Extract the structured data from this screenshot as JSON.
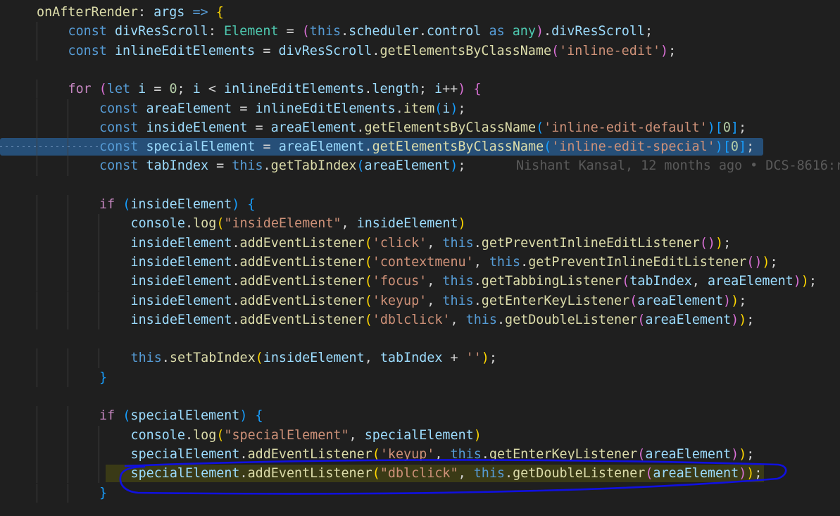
{
  "editor": {
    "language": "TypeScript",
    "lines": [
      {
        "indent": 1,
        "tokens": [
          [
            "fn",
            "onAfterRender"
          ],
          [
            "pl",
            ": "
          ],
          [
            "var",
            "args"
          ],
          [
            "pl",
            " "
          ],
          [
            "kw",
            "=>"
          ],
          [
            "pl",
            " "
          ],
          [
            "p1",
            "{"
          ]
        ]
      },
      {
        "indent": 2,
        "tokens": [
          [
            "kw",
            "const"
          ],
          [
            "pl",
            " "
          ],
          [
            "var",
            "divResScroll"
          ],
          [
            "pl",
            ": "
          ],
          [
            "type",
            "Element"
          ],
          [
            "pl",
            " = "
          ],
          [
            "p2",
            "("
          ],
          [
            "kw",
            "this"
          ],
          [
            "pl",
            "."
          ],
          [
            "var",
            "scheduler"
          ],
          [
            "pl",
            "."
          ],
          [
            "var",
            "control"
          ],
          [
            "pl",
            " "
          ],
          [
            "kw",
            "as"
          ],
          [
            "pl",
            " "
          ],
          [
            "type",
            "any"
          ],
          [
            "p2",
            ")"
          ],
          [
            "pl",
            "."
          ],
          [
            "var",
            "divResScroll"
          ],
          [
            "pl",
            ";"
          ]
        ]
      },
      {
        "indent": 2,
        "tokens": [
          [
            "kw",
            "const"
          ],
          [
            "pl",
            " "
          ],
          [
            "var",
            "inlineEditElements"
          ],
          [
            "pl",
            " = "
          ],
          [
            "var",
            "divResScroll"
          ],
          [
            "pl",
            "."
          ],
          [
            "fn",
            "getElementsByClassName"
          ],
          [
            "p2",
            "("
          ],
          [
            "str",
            "'inline-edit'"
          ],
          [
            "p2",
            ")"
          ],
          [
            "pl",
            ";"
          ]
        ]
      },
      {
        "indent": 0,
        "tokens": []
      },
      {
        "indent": 2,
        "tokens": [
          [
            "ctl",
            "for"
          ],
          [
            "pl",
            " "
          ],
          [
            "p2",
            "("
          ],
          [
            "kw",
            "let"
          ],
          [
            "pl",
            " "
          ],
          [
            "var",
            "i"
          ],
          [
            "pl",
            " = "
          ],
          [
            "num",
            "0"
          ],
          [
            "pl",
            "; "
          ],
          [
            "var",
            "i"
          ],
          [
            "pl",
            " < "
          ],
          [
            "var",
            "inlineEditElements"
          ],
          [
            "pl",
            "."
          ],
          [
            "var",
            "length"
          ],
          [
            "pl",
            "; "
          ],
          [
            "var",
            "i"
          ],
          [
            "pl",
            "++"
          ],
          [
            "p2",
            ")"
          ],
          [
            "pl",
            " "
          ],
          [
            "p2",
            "{"
          ]
        ]
      },
      {
        "indent": 3,
        "tokens": [
          [
            "kw",
            "const"
          ],
          [
            "pl",
            " "
          ],
          [
            "var",
            "areaElement"
          ],
          [
            "pl",
            " = "
          ],
          [
            "var",
            "inlineEditElements"
          ],
          [
            "pl",
            "."
          ],
          [
            "fn",
            "item"
          ],
          [
            "p3",
            "("
          ],
          [
            "var",
            "i"
          ],
          [
            "p3",
            ")"
          ],
          [
            "pl",
            ";"
          ]
        ]
      },
      {
        "indent": 3,
        "tokens": [
          [
            "kw",
            "const"
          ],
          [
            "pl",
            " "
          ],
          [
            "var",
            "insideElement"
          ],
          [
            "pl",
            " = "
          ],
          [
            "var",
            "areaElement"
          ],
          [
            "pl",
            "."
          ],
          [
            "fn",
            "getElementsByClassName"
          ],
          [
            "p3",
            "("
          ],
          [
            "str",
            "'inline-edit-default'"
          ],
          [
            "p3",
            ")"
          ],
          [
            "p3",
            "["
          ],
          [
            "num",
            "0"
          ],
          [
            "p3",
            "]"
          ],
          [
            "pl",
            ";"
          ]
        ]
      },
      {
        "indent": 3,
        "selected": true,
        "tokens": [
          [
            "kw",
            "const"
          ],
          [
            "pl",
            " "
          ],
          [
            "var",
            "specialElement"
          ],
          [
            "pl",
            " = "
          ],
          [
            "var",
            "areaElement"
          ],
          [
            "pl",
            "."
          ],
          [
            "fn",
            "getElementsByClassName"
          ],
          [
            "p3",
            "("
          ],
          [
            "str",
            "'inline-edit-special'"
          ],
          [
            "p3",
            ")"
          ],
          [
            "p3",
            "["
          ],
          [
            "num",
            "0"
          ],
          [
            "p3",
            "]"
          ],
          [
            "pl",
            ";"
          ]
        ]
      },
      {
        "indent": 3,
        "blame": "Nishant Kansal, 12 months ago • DCS-8616:r",
        "tokens": [
          [
            "kw",
            "const"
          ],
          [
            "pl",
            " "
          ],
          [
            "var",
            "tabIndex"
          ],
          [
            "pl",
            " = "
          ],
          [
            "kw",
            "this"
          ],
          [
            "pl",
            "."
          ],
          [
            "fn",
            "getTabIndex"
          ],
          [
            "p3",
            "("
          ],
          [
            "var",
            "areaElement"
          ],
          [
            "p3",
            ")"
          ],
          [
            "pl",
            ";"
          ]
        ]
      },
      {
        "indent": 0,
        "tokens": []
      },
      {
        "indent": 3,
        "tokens": [
          [
            "ctl",
            "if"
          ],
          [
            "pl",
            " "
          ],
          [
            "p3",
            "("
          ],
          [
            "var",
            "insideElement"
          ],
          [
            "p3",
            ")"
          ],
          [
            "pl",
            " "
          ],
          [
            "p3",
            "{"
          ]
        ]
      },
      {
        "indent": 4,
        "tokens": [
          [
            "var",
            "console"
          ],
          [
            "pl",
            "."
          ],
          [
            "fn",
            "log"
          ],
          [
            "p1",
            "("
          ],
          [
            "str",
            "\"insideElement\""
          ],
          [
            "pl",
            ", "
          ],
          [
            "var",
            "insideElement"
          ],
          [
            "p1",
            ")"
          ]
        ]
      },
      {
        "indent": 4,
        "tokens": [
          [
            "var",
            "insideElement"
          ],
          [
            "pl",
            "."
          ],
          [
            "fn",
            "addEventListener"
          ],
          [
            "p1",
            "("
          ],
          [
            "str",
            "'click'"
          ],
          [
            "pl",
            ", "
          ],
          [
            "kw",
            "this"
          ],
          [
            "pl",
            "."
          ],
          [
            "fn",
            "getPreventInlineEditListener"
          ],
          [
            "p2",
            "()"
          ],
          [
            "p1",
            ")"
          ],
          [
            "pl",
            ";"
          ]
        ]
      },
      {
        "indent": 4,
        "tokens": [
          [
            "var",
            "insideElement"
          ],
          [
            "pl",
            "."
          ],
          [
            "fn",
            "addEventListener"
          ],
          [
            "p1",
            "("
          ],
          [
            "str",
            "'contextmenu'"
          ],
          [
            "pl",
            ", "
          ],
          [
            "kw",
            "this"
          ],
          [
            "pl",
            "."
          ],
          [
            "fn",
            "getPreventInlineEditListener"
          ],
          [
            "p2",
            "()"
          ],
          [
            "p1",
            ")"
          ],
          [
            "pl",
            ";"
          ]
        ]
      },
      {
        "indent": 4,
        "tokens": [
          [
            "var",
            "insideElement"
          ],
          [
            "pl",
            "."
          ],
          [
            "fn",
            "addEventListener"
          ],
          [
            "p1",
            "("
          ],
          [
            "str",
            "'focus'"
          ],
          [
            "pl",
            ", "
          ],
          [
            "kw",
            "this"
          ],
          [
            "pl",
            "."
          ],
          [
            "fn",
            "getTabbingListener"
          ],
          [
            "p2",
            "("
          ],
          [
            "var",
            "tabIndex"
          ],
          [
            "pl",
            ", "
          ],
          [
            "var",
            "areaElement"
          ],
          [
            "p2",
            ")"
          ],
          [
            "p1",
            ")"
          ],
          [
            "pl",
            ";"
          ]
        ]
      },
      {
        "indent": 4,
        "tokens": [
          [
            "var",
            "insideElement"
          ],
          [
            "pl",
            "."
          ],
          [
            "fn",
            "addEventListener"
          ],
          [
            "p1",
            "("
          ],
          [
            "str",
            "'keyup'"
          ],
          [
            "pl",
            ", "
          ],
          [
            "kw",
            "this"
          ],
          [
            "pl",
            "."
          ],
          [
            "fn",
            "getEnterKeyListener"
          ],
          [
            "p2",
            "("
          ],
          [
            "var",
            "areaElement"
          ],
          [
            "p2",
            ")"
          ],
          [
            "p1",
            ")"
          ],
          [
            "pl",
            ";"
          ]
        ]
      },
      {
        "indent": 4,
        "tokens": [
          [
            "var",
            "insideElement"
          ],
          [
            "pl",
            "."
          ],
          [
            "fn",
            "addEventListener"
          ],
          [
            "p1",
            "("
          ],
          [
            "str",
            "'dblclick'"
          ],
          [
            "pl",
            ", "
          ],
          [
            "kw",
            "this"
          ],
          [
            "pl",
            "."
          ],
          [
            "fn",
            "getDoubleListener"
          ],
          [
            "p2",
            "("
          ],
          [
            "var",
            "areaElement"
          ],
          [
            "p2",
            ")"
          ],
          [
            "p1",
            ")"
          ],
          [
            "pl",
            ";"
          ]
        ]
      },
      {
        "indent": 0,
        "tokens": []
      },
      {
        "indent": 4,
        "tokens": [
          [
            "kw",
            "this"
          ],
          [
            "pl",
            "."
          ],
          [
            "fn",
            "setTabIndex"
          ],
          [
            "p1",
            "("
          ],
          [
            "var",
            "insideElement"
          ],
          [
            "pl",
            ", "
          ],
          [
            "var",
            "tabIndex"
          ],
          [
            "pl",
            " + "
          ],
          [
            "str",
            "''"
          ],
          [
            "p1",
            ")"
          ],
          [
            "pl",
            ";"
          ]
        ]
      },
      {
        "indent": 3,
        "tokens": [
          [
            "p3",
            "}"
          ]
        ]
      },
      {
        "indent": 0,
        "tokens": []
      },
      {
        "indent": 3,
        "tokens": [
          [
            "ctl",
            "if"
          ],
          [
            "pl",
            " "
          ],
          [
            "p3",
            "("
          ],
          [
            "var",
            "specialElement"
          ],
          [
            "p3",
            ")"
          ],
          [
            "pl",
            " "
          ],
          [
            "p3",
            "{"
          ]
        ]
      },
      {
        "indent": 4,
        "tokens": [
          [
            "var",
            "console"
          ],
          [
            "pl",
            "."
          ],
          [
            "fn",
            "log"
          ],
          [
            "p1",
            "("
          ],
          [
            "str",
            "\"specialElement\""
          ],
          [
            "pl",
            ", "
          ],
          [
            "var",
            "specialElement"
          ],
          [
            "p1",
            ")"
          ]
        ]
      },
      {
        "indent": 4,
        "tokens": [
          [
            "var",
            "specialElement"
          ],
          [
            "pl",
            "."
          ],
          [
            "fn",
            "addEventListener"
          ],
          [
            "p1",
            "("
          ],
          [
            "str",
            "'keyup'"
          ],
          [
            "pl",
            ", "
          ],
          [
            "kw",
            "this"
          ],
          [
            "pl",
            "."
          ],
          [
            "fn",
            "getEnterKeyListener"
          ],
          [
            "p2",
            "("
          ],
          [
            "var",
            "areaElement"
          ],
          [
            "p2",
            ")"
          ],
          [
            "p1",
            ")"
          ],
          [
            "pl",
            ";"
          ]
        ]
      },
      {
        "indent": 4,
        "current": true,
        "tokens": [
          [
            "var",
            "specialElement"
          ],
          [
            "pl",
            "."
          ],
          [
            "fn",
            "addEventListener"
          ],
          [
            "p1",
            "("
          ],
          [
            "str",
            "\"dblclick\""
          ],
          [
            "pl",
            ", "
          ],
          [
            "kw",
            "this"
          ],
          [
            "pl",
            "."
          ],
          [
            "fn",
            "getDoubleListener"
          ],
          [
            "p2",
            "("
          ],
          [
            "var",
            "areaElement"
          ],
          [
            "p2",
            ")"
          ],
          [
            "p1",
            ")"
          ],
          [
            "pl",
            ";"
          ]
        ]
      },
      {
        "indent": 3,
        "tokens": [
          [
            "p3",
            "}"
          ]
        ]
      }
    ]
  },
  "annotation": {
    "kind": "hand-drawn-ellipse",
    "color": "#1010e0"
  }
}
